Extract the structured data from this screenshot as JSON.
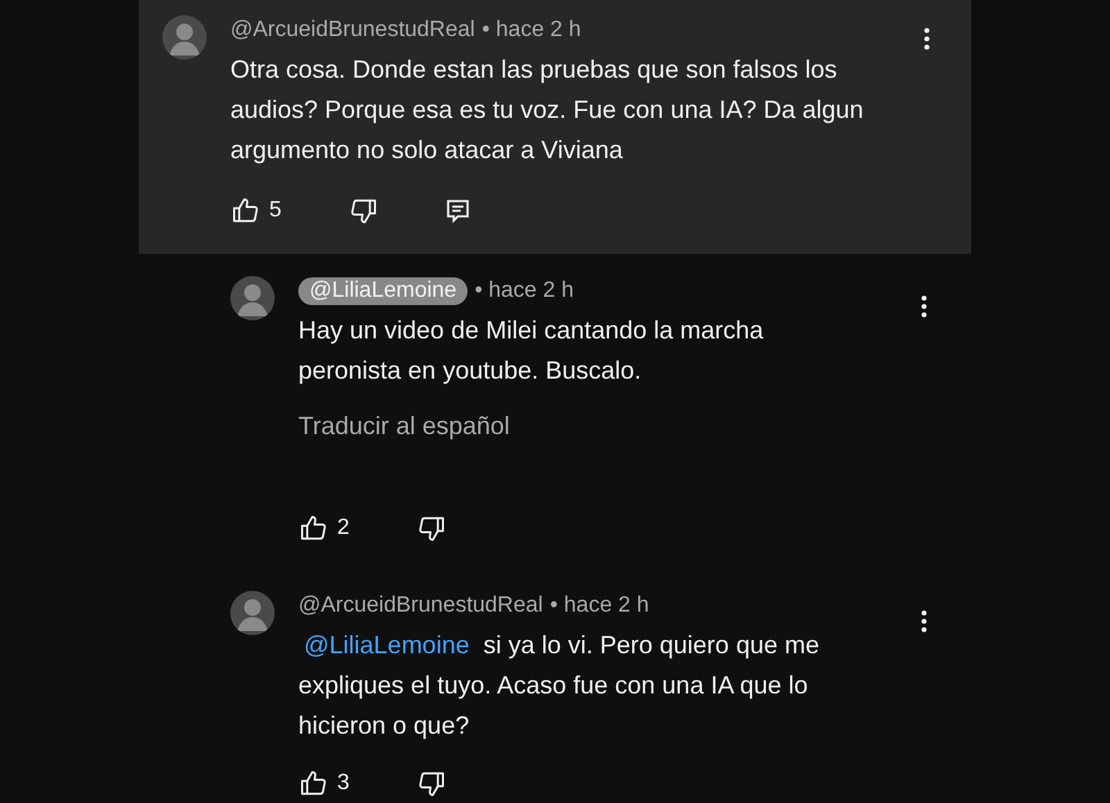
{
  "comments": [
    {
      "author": "@ArcueidBrunestudReal",
      "creator": false,
      "time": "• hace 2 h",
      "highlighted": true,
      "text": "Otra cosa. Donde estan las pruebas que son falsos los audios? Porque esa es tu voz. Fue con una IA? Da algun argumento no solo atacar a Viviana",
      "likes": "5",
      "reply_icon": true,
      "children": [
        {
          "author": "@LiliaLemoine",
          "creator": true,
          "time": "• hace 2 h",
          "highlighted": false,
          "text": "Hay un video de Milei cantando la marcha peronista en youtube. Buscalo.",
          "translate": "Traducir al español",
          "likes": "2",
          "reply_icon": false
        },
        {
          "author": "@ArcueidBrunestudReal",
          "creator": false,
          "time": "• hace 2 h",
          "highlighted": false,
          "mention": "@LiliaLemoine",
          "text": "si ya lo vi. Pero quiero que me expliques el tuyo. Acaso fue con una IA que lo hicieron o que?",
          "likes": "3",
          "reply_icon": false
        }
      ]
    }
  ]
}
